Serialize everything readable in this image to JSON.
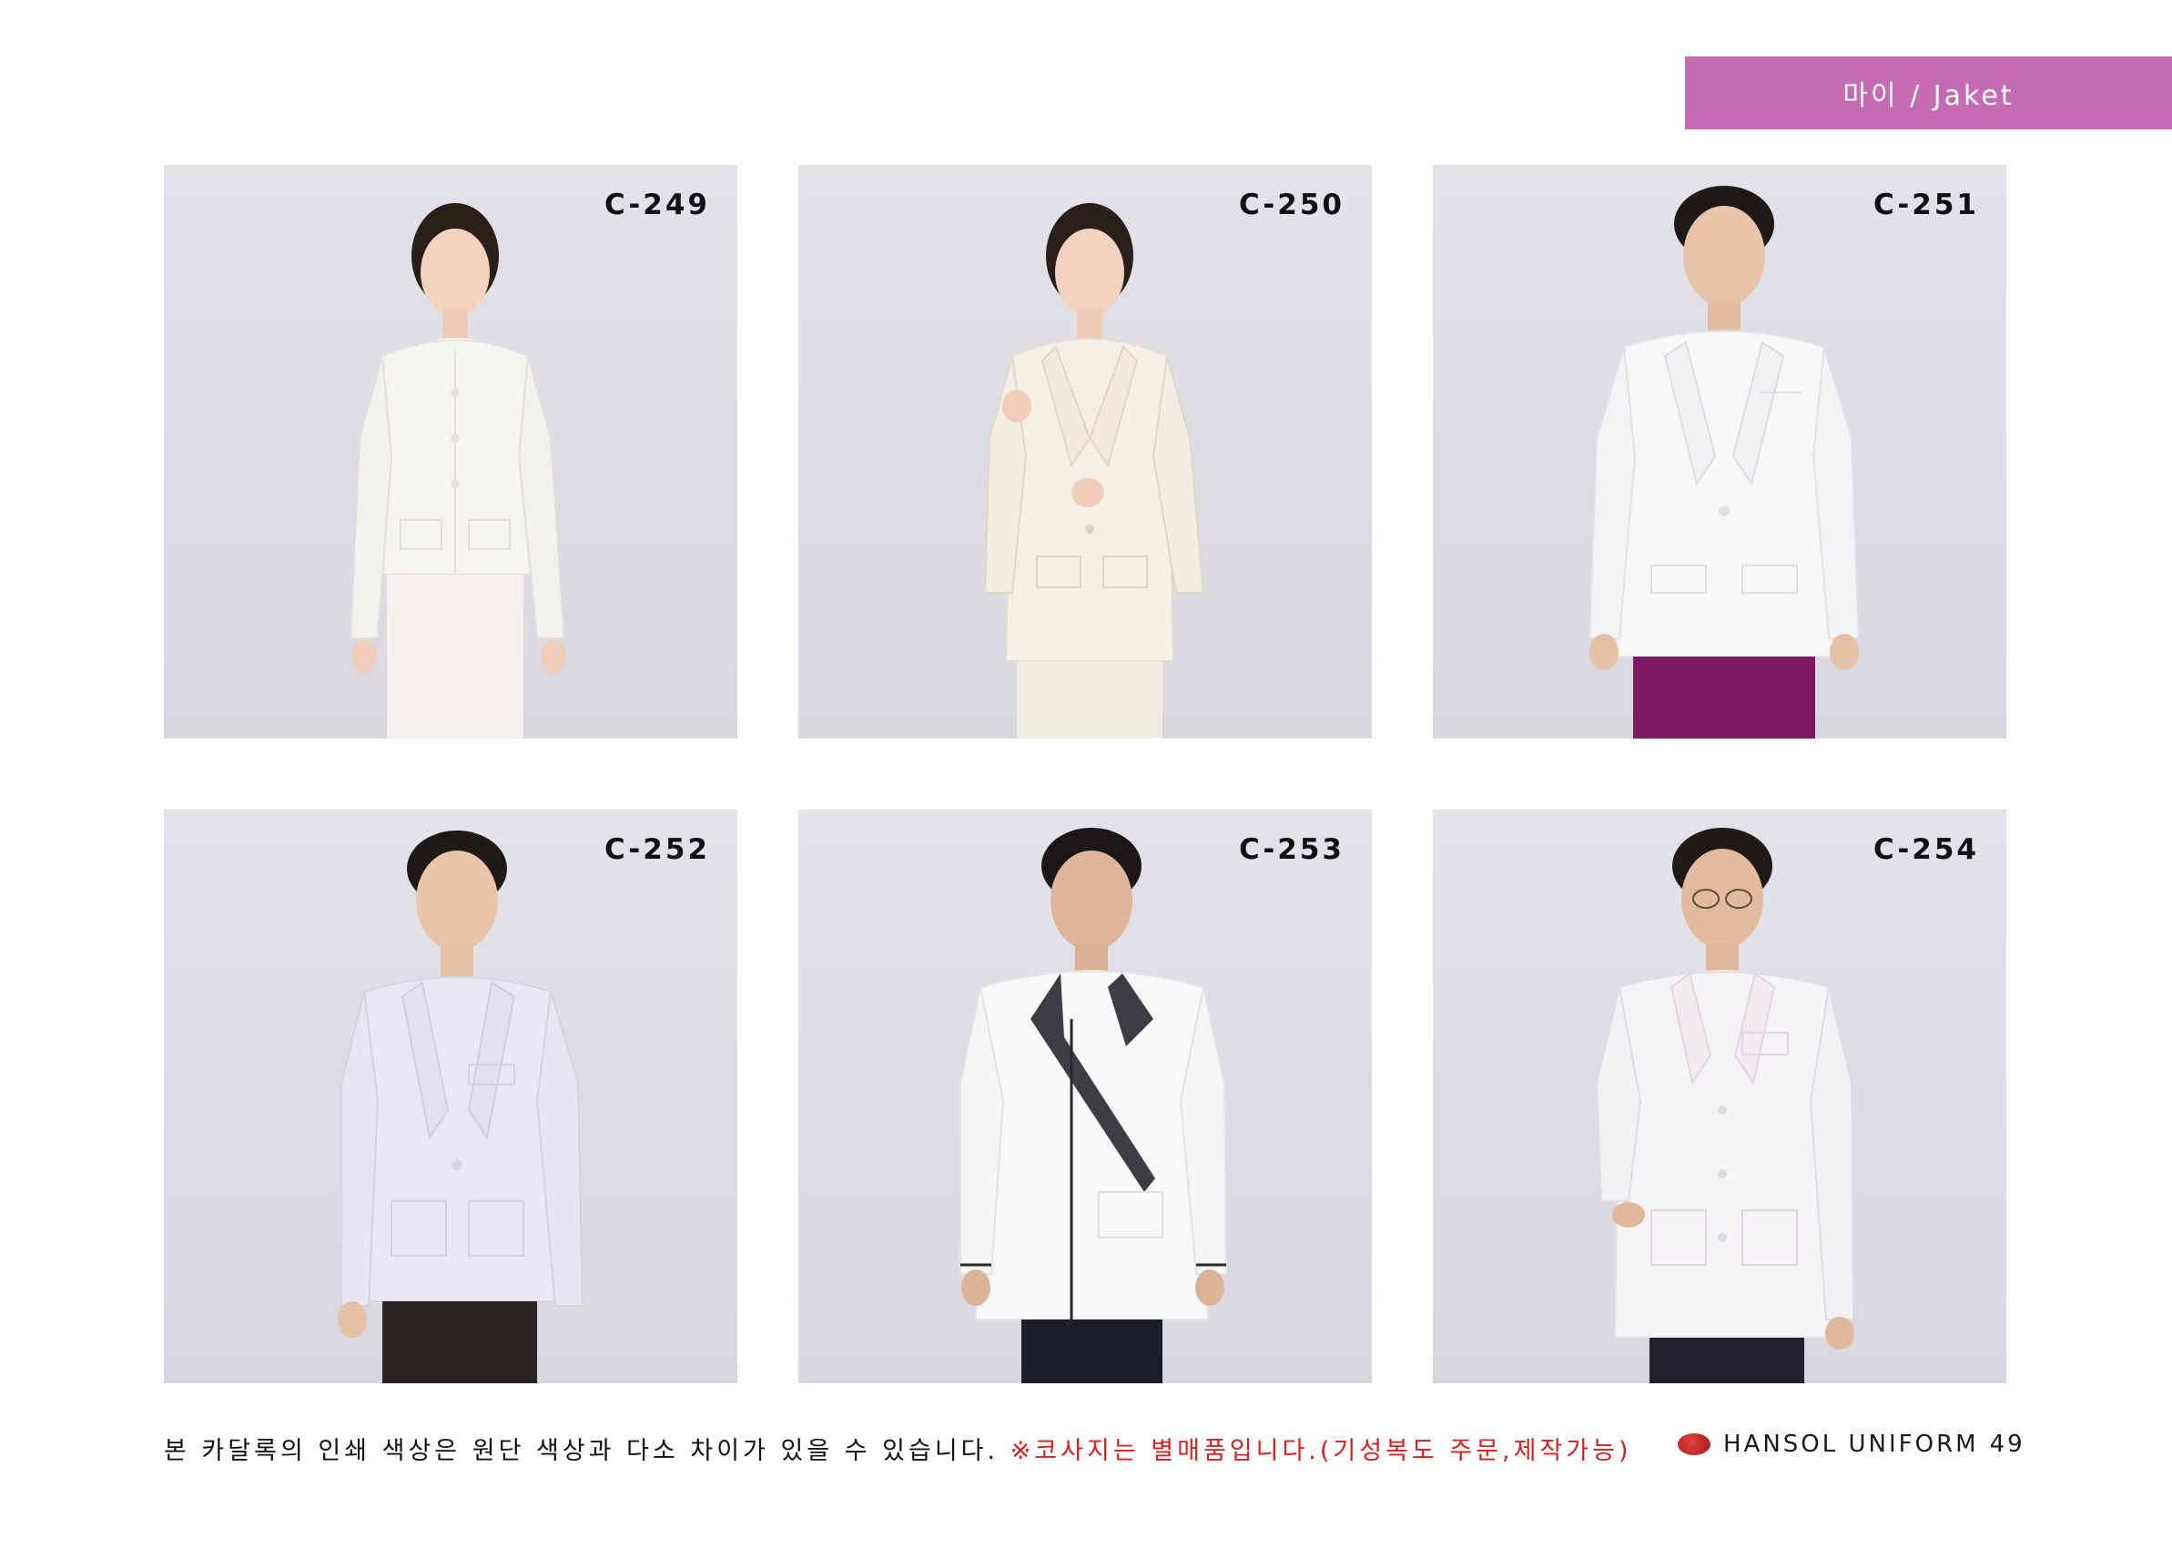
{
  "header": {
    "tab_label": "마이 / Jaket",
    "tab_color": "#c46bb3"
  },
  "products": [
    {
      "code": "C-249",
      "model": "woman",
      "jacket_color": "#f6f4f1",
      "inner_color": "#ffffff",
      "pants_color": "#f4f1ec",
      "style": "collarless"
    },
    {
      "code": "C-250",
      "model": "woman",
      "jacket_color": "#f4f0e6",
      "inner_color": "#faf8f3",
      "pants_color": "#f1ece2",
      "style": "lapel"
    },
    {
      "code": "C-251",
      "model": "man",
      "jacket_color": "#f7f7f8",
      "inner_color": "#8c1f6f",
      "pants_color": "#7e1a63",
      "style": "lapel"
    },
    {
      "code": "C-252",
      "model": "man",
      "jacket_color": "#e9e8f2",
      "inner_color": "#f6f6f6",
      "pants_color": "#2a2522",
      "style": "lapel-tie"
    },
    {
      "code": "C-253",
      "model": "man",
      "jacket_color": "#f8f8f8",
      "inner_color": "#f6f6f6",
      "pants_color": "#1c1f2a",
      "style": "hanbok"
    },
    {
      "code": "C-254",
      "model": "man",
      "jacket_color": "#f6f3f6",
      "inner_color": "#e8e8ee",
      "pants_color": "#22222a",
      "style": "lapel-tie"
    }
  ],
  "footer": {
    "notice": "본 카달록의 인쇄 색상은 원단 색상과 다소 차이가 있을 수 있습니다.",
    "notice_red": "※코사지는 별매품입니다.(기성복도 주문,제작가능)",
    "notice_red_color": "#d8201f",
    "brand": "HANSOL UNIFORM",
    "page_number": "49"
  }
}
